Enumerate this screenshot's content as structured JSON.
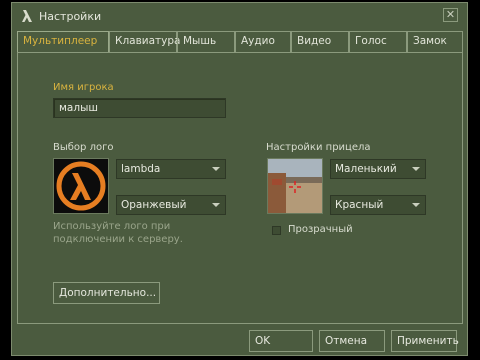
{
  "window": {
    "title": "Настройки",
    "close_symbol": "✕",
    "icon": "half-life-lambda-icon"
  },
  "tabs": [
    {
      "label": "Мультиплеер",
      "active": true
    },
    {
      "label": "Клавиатура",
      "active": false
    },
    {
      "label": "Мышь",
      "active": false
    },
    {
      "label": "Аудио",
      "active": false
    },
    {
      "label": "Видео",
      "active": false
    },
    {
      "label": "Голос",
      "active": false
    },
    {
      "label": "Замок",
      "active": false
    }
  ],
  "player": {
    "label": "Имя игрока",
    "name": "малыш"
  },
  "logo": {
    "label": "Выбор лого",
    "selected": "lambda",
    "color": "Оранжевый",
    "hint": "Используйте лого при подключении к серверу."
  },
  "crosshair": {
    "label": "Настройки прицела",
    "size": "Маленький",
    "color": "Красный",
    "transparent_label": "Прозрачный"
  },
  "buttons": {
    "advanced": "Дополнительно...",
    "ok": "OK",
    "cancel": "Отмена",
    "apply": "Применить"
  },
  "colors": {
    "accent": "#d9b33f",
    "window_bg": "#4b5b3f",
    "logo_orange": "#e67e22"
  }
}
